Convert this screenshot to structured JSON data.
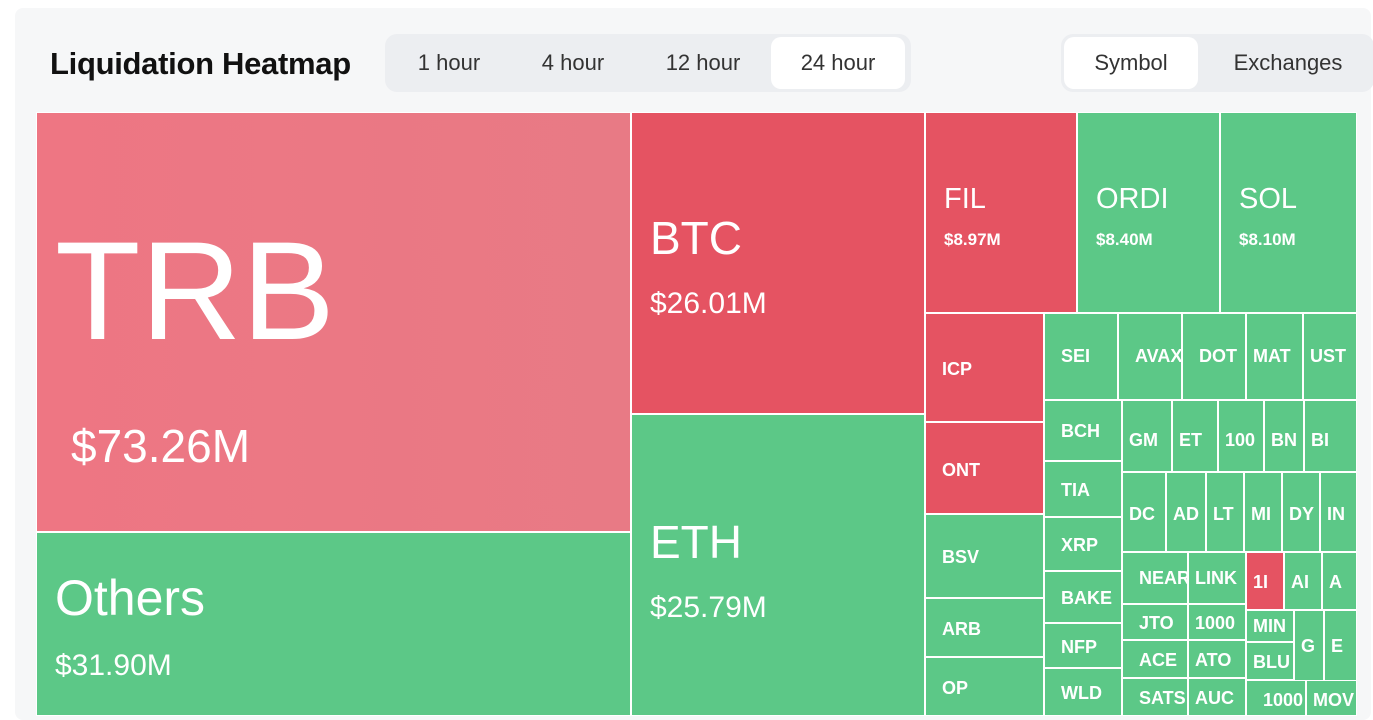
{
  "header": {
    "title": "Liquidation Heatmap",
    "time_tabs": [
      {
        "label": "1 hour",
        "active": false
      },
      {
        "label": "4 hour",
        "active": false
      },
      {
        "label": "12 hour",
        "active": false
      },
      {
        "label": "24 hour",
        "active": true
      }
    ],
    "view_tabs": [
      {
        "label": "Symbol",
        "active": true
      },
      {
        "label": "Exchanges",
        "active": false
      }
    ]
  },
  "colors": {
    "long_liquidation": "#e55362",
    "short_liquidation": "#5cc887",
    "top_tile": "#ec7783"
  },
  "tiles": [
    {
      "symbol": "TRB",
      "value": "$73.26M",
      "color": "pink"
    },
    {
      "symbol": "Others",
      "value": "$31.90M",
      "color": "green"
    },
    {
      "symbol": "BTC",
      "value": "$26.01M",
      "color": "red"
    },
    {
      "symbol": "ETH",
      "value": "$25.79M",
      "color": "green"
    },
    {
      "symbol": "FIL",
      "value": "$8.97M",
      "color": "red"
    },
    {
      "symbol": "ORDI",
      "value": "$8.40M",
      "color": "green"
    },
    {
      "symbol": "SOL",
      "value": "$8.10M",
      "color": "green"
    },
    {
      "symbol": "ICP",
      "color": "red"
    },
    {
      "symbol": "ONT",
      "color": "red"
    },
    {
      "symbol": "BSV",
      "color": "green"
    },
    {
      "symbol": "ARB",
      "color": "green"
    },
    {
      "symbol": "OP",
      "color": "green"
    },
    {
      "symbol": "SEI",
      "color": "green"
    },
    {
      "symbol": "AVAX",
      "color": "green"
    },
    {
      "symbol": "DOT",
      "color": "green"
    },
    {
      "symbol": "MAT",
      "color": "green"
    },
    {
      "symbol": "UST",
      "color": "green"
    },
    {
      "symbol": "BCH",
      "color": "green"
    },
    {
      "symbol": "TIA",
      "color": "green"
    },
    {
      "symbol": "XRP",
      "color": "green"
    },
    {
      "symbol": "BAKE",
      "color": "green"
    },
    {
      "symbol": "NFP",
      "color": "green"
    },
    {
      "symbol": "WLD",
      "color": "green"
    },
    {
      "symbol": "GM",
      "color": "green"
    },
    {
      "symbol": "ET",
      "color": "green"
    },
    {
      "symbol": "100",
      "color": "green"
    },
    {
      "symbol": "BN",
      "color": "green"
    },
    {
      "symbol": "BI",
      "color": "green"
    },
    {
      "symbol": "DC",
      "color": "green"
    },
    {
      "symbol": "AD",
      "color": "green"
    },
    {
      "symbol": "LT",
      "color": "green"
    },
    {
      "symbol": "MI",
      "color": "green"
    },
    {
      "symbol": "DY",
      "color": "green"
    },
    {
      "symbol": "IN",
      "color": "green"
    },
    {
      "symbol": "NEAR",
      "color": "green"
    },
    {
      "symbol": "LINK",
      "color": "green"
    },
    {
      "symbol": "1I",
      "color": "red"
    },
    {
      "symbol": "AI",
      "color": "green"
    },
    {
      "symbol": "A",
      "color": "green"
    },
    {
      "symbol": "JTO",
      "color": "green"
    },
    {
      "symbol": "1000",
      "color": "green"
    },
    {
      "symbol": "MIN",
      "color": "green"
    },
    {
      "symbol": "G",
      "color": "green"
    },
    {
      "symbol": "E",
      "color": "green"
    },
    {
      "symbol": "ACE",
      "color": "green"
    },
    {
      "symbol": "ATO",
      "color": "green"
    },
    {
      "symbol": "BLU",
      "color": "green"
    },
    {
      "symbol": "SATS",
      "color": "green"
    },
    {
      "symbol": "AUC",
      "color": "green"
    },
    {
      "symbol": "1000",
      "color": "green"
    },
    {
      "symbol": "MOV",
      "color": "green"
    }
  ]
}
